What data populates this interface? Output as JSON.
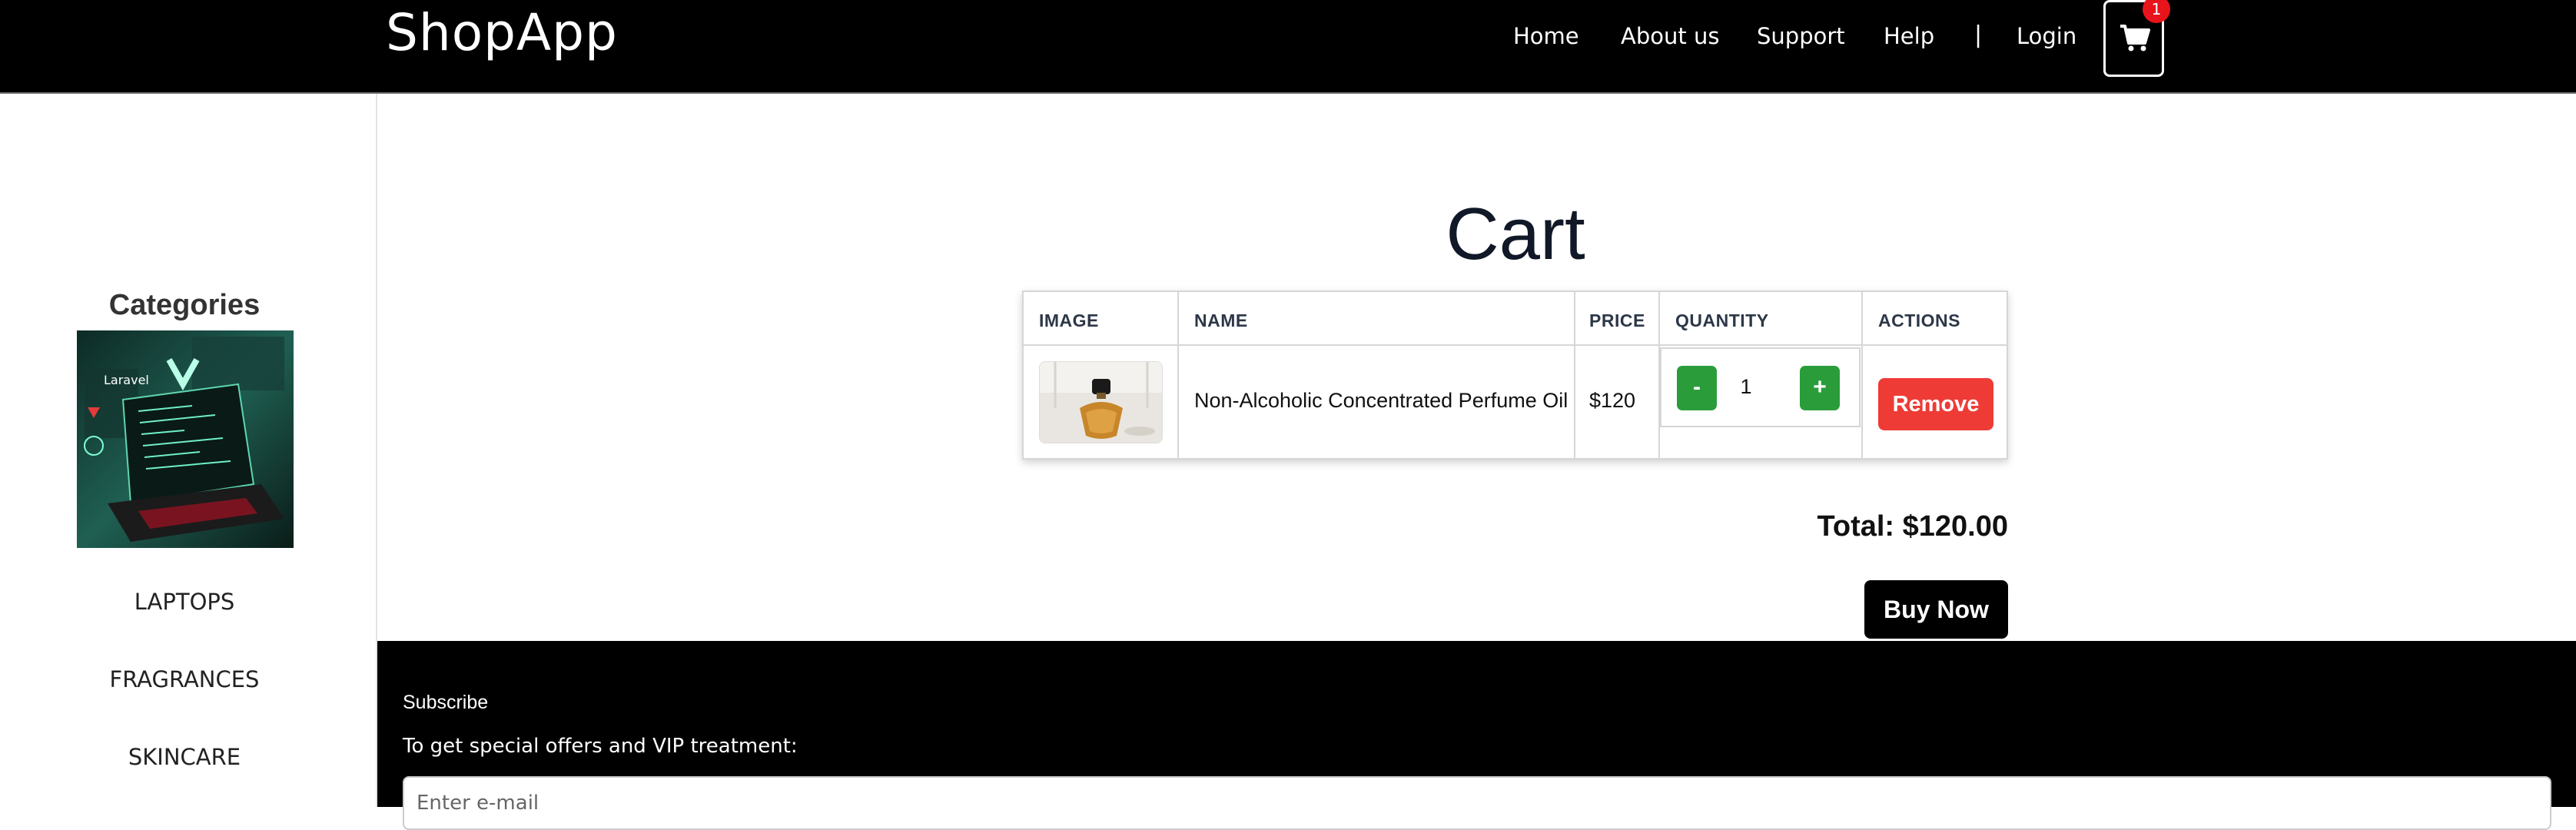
{
  "header": {
    "logo": "ShopApp",
    "nav": [
      "Home",
      "About us",
      "Support",
      "Help"
    ],
    "separator": "|",
    "login": "Login",
    "cart_count": "1"
  },
  "sidebar": {
    "title": "Categories",
    "items": [
      "LAPTOPS",
      "FRAGRANCES",
      "SKINCARE"
    ]
  },
  "cart": {
    "title": "Cart",
    "columns": [
      "IMAGE",
      "NAME",
      "PRICE",
      "QUANTITY",
      "ACTIONS"
    ],
    "rows": [
      {
        "name": "Non-Alcoholic Concentrated Perfume Oil",
        "price": "$120",
        "quantity": "1",
        "decrement": "-",
        "increment": "+",
        "remove": "Remove"
      }
    ],
    "total": "Total: $120.00",
    "buy": "Buy Now"
  },
  "footer": {
    "subscribe_title": "Subscribe",
    "subscribe_text": "To get special offers and VIP treatment:",
    "email_placeholder": "Enter e-mail"
  },
  "colors": {
    "header_bg": "#000000",
    "qty_button": "#2a9d3a",
    "remove_button": "#ef3b36",
    "badge": "#e8141c"
  }
}
